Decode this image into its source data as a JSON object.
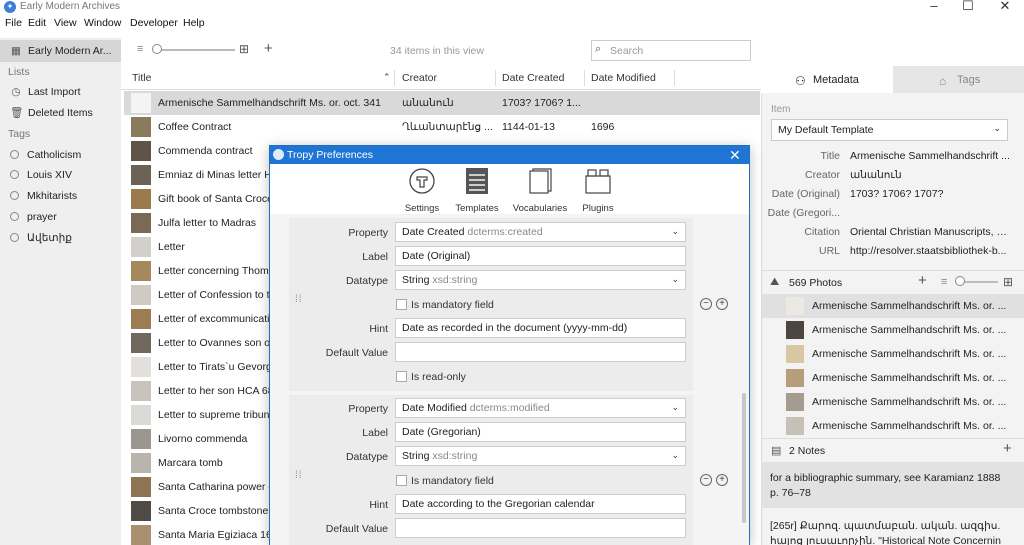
{
  "app": {
    "title": "Early Modern Archives",
    "logo_icon": "tropy-logo-icon"
  },
  "menu": [
    "File",
    "Edit",
    "View",
    "Window",
    "Developer",
    "Help"
  ],
  "sidebar": {
    "project": "Early Modern Ar...",
    "lists_heading": "Lists",
    "lists": [
      "Last Import",
      "Deleted Items"
    ],
    "tags_heading": "Tags",
    "tags": [
      "Catholicism",
      "Louis XIV",
      "Mkhitarists",
      "prayer",
      "Ավետիք"
    ]
  },
  "items": {
    "count": "34 items in this view",
    "search_placeholder": "Search",
    "columns": [
      "Title",
      "Creator",
      "Date Created",
      "Date Modified"
    ],
    "rows": [
      {
        "title": "Armenische Sammelhandschrift Ms. or. oct. 341",
        "creator": "անանուն",
        "created": "1703? 1706? 1...",
        "modified": "",
        "tone": "#f4f4f4"
      },
      {
        "title": "Coffee Contract",
        "creator": "Ղևանտարէնց ...",
        "created": "1144-01-13",
        "modified": "1696",
        "tone": "#8a7a5c"
      },
      {
        "title": "Commenda contract",
        "creator": "",
        "created": "",
        "modified": "",
        "tone": "#5e5448"
      },
      {
        "title": "Emniaz di Minas letter H",
        "creator": "",
        "created": "",
        "modified": "",
        "tone": "#6d6256"
      },
      {
        "title": "Gift book of Santa Croce",
        "creator": "",
        "created": "",
        "modified": "",
        "tone": "#9a7b4e"
      },
      {
        "title": "Julfa letter to Madras",
        "creator": "",
        "created": "",
        "modified": "",
        "tone": "#7a6a55"
      },
      {
        "title": "Letter",
        "creator": "",
        "created": "",
        "modified": "",
        "tone": "#d2d0cc"
      },
      {
        "title": "Letter concerning Thoma",
        "creator": "",
        "created": "",
        "modified": "",
        "tone": "#a5885c"
      },
      {
        "title": "Letter of Confession to t",
        "creator": "",
        "created": "",
        "modified": "",
        "tone": "#cfcbc4"
      },
      {
        "title": "Letter of excommunicati",
        "creator": "",
        "created": "",
        "modified": "",
        "tone": "#9c7d52"
      },
      {
        "title": "Letter to Ovannes son o",
        "creator": "",
        "created": "",
        "modified": "",
        "tone": "#70685e"
      },
      {
        "title": "Letter to Tirats`u Gevorg",
        "creator": "",
        "created": "",
        "modified": "",
        "tone": "#e2e0dc"
      },
      {
        "title": "Letter to her son HCA 68",
        "creator": "",
        "created": "",
        "modified": "",
        "tone": "#c8c4bc"
      },
      {
        "title": "Letter to supreme tribun",
        "creator": "",
        "created": "",
        "modified": "",
        "tone": "#dcdad6"
      },
      {
        "title": "Livorno commenda",
        "creator": "",
        "created": "",
        "modified": "",
        "tone": "#9a9690"
      },
      {
        "title": "Marcara tomb",
        "creator": "",
        "created": "",
        "modified": "",
        "tone": "#b9b5ae"
      },
      {
        "title": "Santa Catharina power o",
        "creator": "",
        "created": "",
        "modified": "",
        "tone": "#8e7452"
      },
      {
        "title": "Santa Croce tombstone",
        "creator": "",
        "created": "",
        "modified": "",
        "tone": "#4e4a46"
      },
      {
        "title": "Santa Maria Egiziaca 169",
        "creator": "",
        "created": "",
        "modified": "",
        "tone": "#a89070"
      }
    ]
  },
  "panel": {
    "tab_metadata": "Metadata",
    "tab_tags": "Tags",
    "item_heading": "Item",
    "template": "My Default Template",
    "fields": [
      {
        "label": "Title",
        "value": "Armenische Sammelhandschrift ..."
      },
      {
        "label": "Creator",
        "value": "անանուն"
      },
      {
        "label": "Date (Original)",
        "value": "1703? 1706? 1707?"
      },
      {
        "label": "Date (Gregori...",
        "value": ""
      },
      {
        "label": "Citation",
        "value": "Oriental Christian Manuscripts, N..."
      },
      {
        "label": "URL",
        "value": "http://resolver.staatsbibliothek-b..."
      }
    ],
    "photos_heading": "569 Photos",
    "photos": [
      {
        "label": "Armenische Sammelhandschrift Ms. or. ...",
        "tone": "#ece9e2"
      },
      {
        "label": "Armenische Sammelhandschrift Ms. or. ...",
        "tone": "#4c4540"
      },
      {
        "label": "Armenische Sammelhandschrift Ms. or. ...",
        "tone": "#d9c6a2"
      },
      {
        "label": "Armenische Sammelhandschrift Ms. or. ...",
        "tone": "#b79e7a"
      },
      {
        "label": "Armenische Sammelhandschrift Ms. or. ...",
        "tone": "#a49c90"
      },
      {
        "label": "Armenische Sammelhandschrift Ms. or. ...",
        "tone": "#c6c0b6"
      }
    ],
    "notes_heading": "2 Notes",
    "notes": [
      "for a bibliographic summary, see Karamianz 1888 p. 76–78",
      "[265r] Քարոզ. պատմաբան. ական. ազգիս. հայոց լուսաւորչին. \"Historical Note Concernin"
    ]
  },
  "prefs": {
    "title": "Tropy Preferences",
    "tabs": [
      "Settings",
      "Templates",
      "Vocabularies",
      "Plugins"
    ],
    "labels": {
      "property": "Property",
      "label": "Label",
      "datatype": "Datatype",
      "mandatory": "Is mandatory field",
      "hint": "Hint",
      "default": "Default Value",
      "readonly": "Is read-only"
    },
    "card1": {
      "property": "Date Created",
      "property_uri": "dcterms:created",
      "label": "Date (Original)",
      "datatype": "String",
      "datatype_uri": "xsd:string",
      "hint": "Date as recorded in the document (yyyy-mm-dd)",
      "default": ""
    },
    "card2": {
      "property": "Date Modified",
      "property_uri": "dcterms:modified",
      "label": "Date (Gregorian)",
      "datatype": "String",
      "datatype_uri": "xsd:string",
      "hint": "Date according to the Gregorian calendar",
      "default": ""
    }
  },
  "colors": {
    "accent": "#1f75d3",
    "selection": "#d9d9d9",
    "sidebar": "#efefef"
  }
}
